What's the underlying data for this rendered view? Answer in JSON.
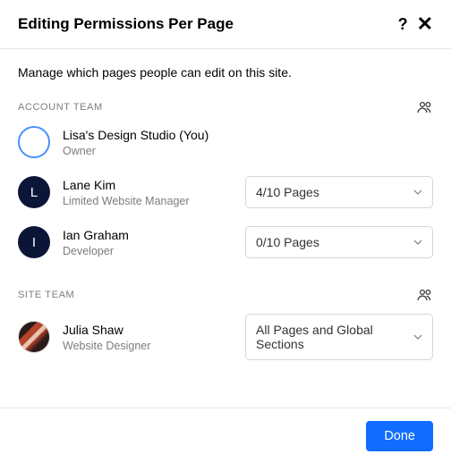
{
  "header": {
    "title": "Editing Permissions Per Page"
  },
  "description": "Manage which pages people can edit on this site.",
  "sections": {
    "account": {
      "label": "ACCOUNT TEAM"
    },
    "site": {
      "label": "SITE TEAM"
    }
  },
  "people": {
    "owner": {
      "name": "Lisa's Design Studio (You)",
      "role": "Owner"
    },
    "lane": {
      "name": "Lane Kim",
      "role": "Limited Website Manager",
      "initial": "L",
      "scope": "4/10 Pages"
    },
    "ian": {
      "name": "Ian Graham",
      "role": "Developer",
      "initial": "I",
      "scope": "0/10 Pages"
    },
    "julia": {
      "name": "Julia Shaw",
      "role": "Website Designer",
      "scope": "All Pages and Global Sections"
    }
  },
  "footer": {
    "done": "Done"
  }
}
